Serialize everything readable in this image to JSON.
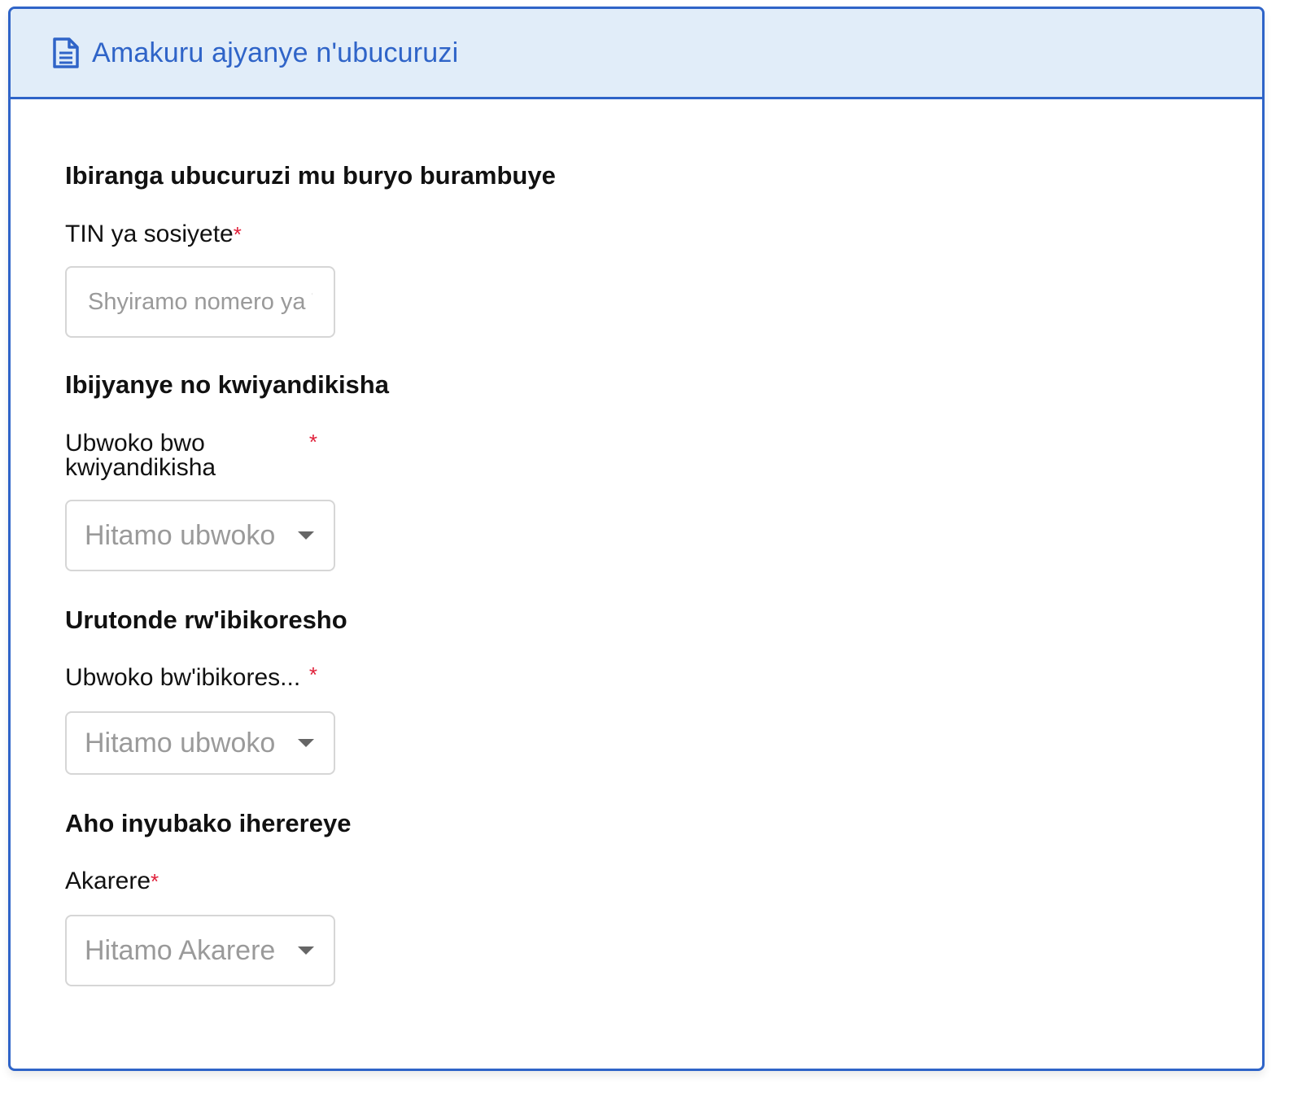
{
  "header": {
    "title": "Amakuru ajyanye n'ubucuruzi",
    "icon": "document-icon",
    "accent_color": "#2f64c8",
    "background_color": "#e1edf9"
  },
  "sections": [
    {
      "title": "Ibiranga ubucuruzi mu buryo burambuye",
      "field": {
        "label": "TIN ya sosiyete",
        "required_mark": "*",
        "placeholder": "Shyiramo nomero ya TIN",
        "value": ""
      }
    },
    {
      "title": "Ibijyanye no kwiyandikisha",
      "field": {
        "label_line1": "Ubwoko bwo",
        "label_line2": "kwiyandikisha",
        "required_mark": "*",
        "selected": "Hitamo ubwoko"
      }
    },
    {
      "title": "Urutonde rw'ibikoresho",
      "field": {
        "label": "Ubwoko bw'ibikores...",
        "required_mark": "*",
        "selected": "Hitamo ubwoko"
      }
    },
    {
      "title": "Aho inyubako iherereye",
      "field": {
        "label": "Akarere",
        "required_mark": "*",
        "selected": "Hitamo Akarere"
      }
    }
  ],
  "colors": {
    "required": "#e0203a",
    "placeholder": "#9a9a9a",
    "input_border": "#d6d6d6"
  }
}
